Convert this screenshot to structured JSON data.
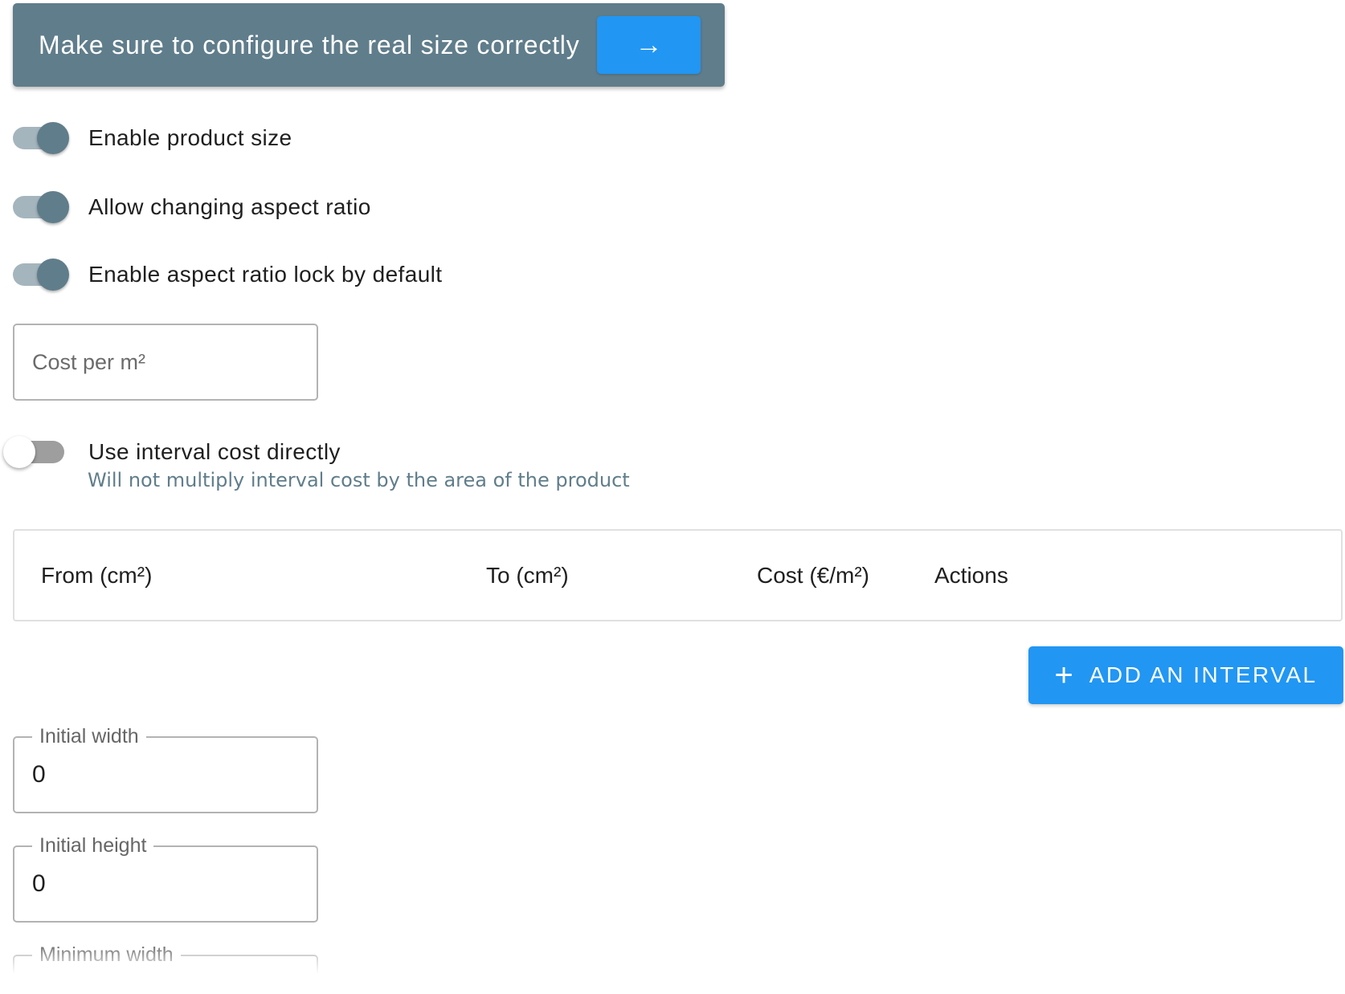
{
  "banner": {
    "text": "Make sure to configure the real size correctly",
    "button_icon": "→",
    "background_color": "#607d8b",
    "button_color": "#2196f3"
  },
  "switches": [
    {
      "label": "Enable product size",
      "checked": true
    },
    {
      "label": "Allow changing aspect ratio",
      "checked": true
    },
    {
      "label": "Enable aspect ratio lock by default",
      "checked": true
    }
  ],
  "cost_field": {
    "placeholder": "Cost per m²",
    "value": ""
  },
  "interval_switch": {
    "label": "Use interval cost directly",
    "sublabel": "Will not multiply interval cost by the area of the product",
    "checked": false
  },
  "interval_table": {
    "headers": [
      "From (cm²)",
      "To (cm²)",
      "Cost (€/m²)",
      "Actions"
    ],
    "rows": []
  },
  "add_interval": {
    "icon": "+",
    "label": "ADD AN INTERVAL"
  },
  "initial_width": {
    "label": "Initial width",
    "value": "0"
  },
  "initial_height": {
    "label": "Initial height",
    "value": "0"
  },
  "minimum_width": {
    "label": "Minimum width",
    "value": ""
  },
  "colors": {
    "primary": "#607d8b",
    "accent": "#2196f3",
    "secondary_text": "#607d8b"
  }
}
